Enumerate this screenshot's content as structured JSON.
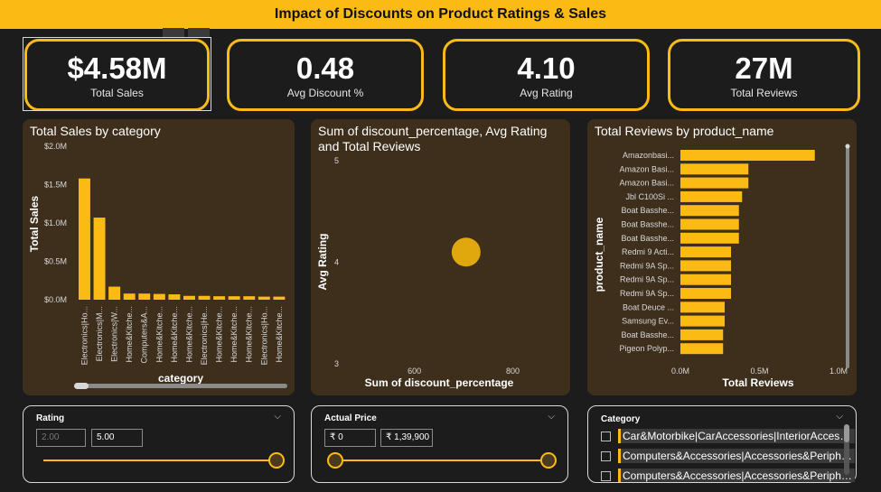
{
  "header": {
    "title": "Impact of Discounts on Product Ratings & Sales"
  },
  "kpis": [
    {
      "value": "$4.58M",
      "label": "Total Sales"
    },
    {
      "value": "0.48",
      "label": "Avg Discount %"
    },
    {
      "value": "4.10",
      "label": "Avg Rating"
    },
    {
      "value": "27M",
      "label": "Total Reviews"
    }
  ],
  "colors": {
    "accent": "#fcbb14",
    "panel": "#3e2f1d",
    "background": "#1c1c1c"
  },
  "chart_data": [
    {
      "type": "bar",
      "title": "Total Sales by category",
      "xlabel": "category",
      "ylabel": "Total Sales",
      "y_ticks": [
        "$0.0M",
        "$0.5M",
        "$1.0M",
        "$1.5M",
        "$2.0M"
      ],
      "ylim": [
        0,
        2.0
      ],
      "categories": [
        "Electronics|Ho...",
        "Electronics|M...",
        "Electronics|W...",
        "Home&Kitche...",
        "Computers&A...",
        "Home&Kitche...",
        "Home&Kitche...",
        "Home&Kitche...",
        "Electronics|He...",
        "Home&Kitche...",
        "Home&Kitche...",
        "Home&Kitche...",
        "Electronics|Ho...",
        "Home&Kitche..."
      ],
      "values": [
        1.58,
        1.07,
        0.17,
        0.08,
        0.08,
        0.075,
        0.07,
        0.05,
        0.05,
        0.045,
        0.045,
        0.045,
        0.04,
        0.04
      ]
    },
    {
      "type": "scatter",
      "title": "Sum of discount_percentage, Avg Rating and Total Reviews",
      "xlabel": "Sum of discount_percentage",
      "ylabel": "Avg Rating",
      "x_ticks": [
        "600",
        "800"
      ],
      "y_ticks": [
        "3",
        "4",
        "5"
      ],
      "xlim": [
        450,
        900
      ],
      "ylim": [
        3,
        5
      ],
      "points": [
        {
          "x": 705,
          "y": 4.1
        }
      ]
    },
    {
      "type": "bar",
      "orientation": "horizontal",
      "title": "Total Reviews by product_name",
      "xlabel": "Total Reviews",
      "ylabel": "product_name",
      "x_ticks": [
        "0.0M",
        "0.5M",
        "1.0M"
      ],
      "xlim": [
        0,
        1.0
      ],
      "categories": [
        "Amazonbasi...",
        "Amazon Basi...",
        "Amazon Basi...",
        "Jbl C100Si ...",
        "Boat Basshe...",
        "Boat Basshe...",
        "Boat Basshe...",
        "Redmi 9 Acti...",
        "Redmi 9A Sp...",
        "Redmi 9A Sp...",
        "Redmi 9A Sp...",
        "Boat Deuce ...",
        "Samsung Ev...",
        "Boat Basshe...",
        "Pigeon Polyp..."
      ],
      "values": [
        0.85,
        0.43,
        0.43,
        0.39,
        0.37,
        0.37,
        0.37,
        0.32,
        0.32,
        0.32,
        0.32,
        0.28,
        0.28,
        0.27,
        0.27
      ]
    }
  ],
  "slicers": {
    "rating": {
      "title": "Rating",
      "min_value": "2.00",
      "max_value": "5.00"
    },
    "price": {
      "title": "Actual Price",
      "min_value": "₹ 0",
      "max_value": "₹ 1,39,900"
    },
    "category": {
      "title": "Category",
      "items": [
        "Car&Motorbike|CarAccessories|InteriorAccessories|AirPurifiers&Ionizers",
        "Computers&Accessories|Accessories&Peripherals|Adapters",
        "Computers&Accessories|Accessories&Peripherals|Audio&VideoAccessories"
      ]
    }
  },
  "icons": {
    "chevron": "chevron-down-icon"
  }
}
